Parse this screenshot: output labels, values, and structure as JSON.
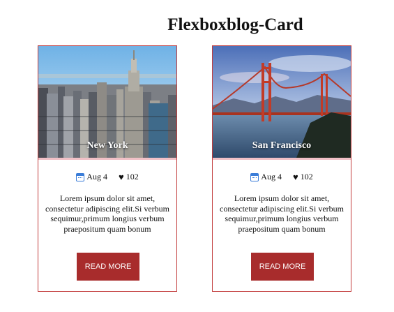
{
  "page": {
    "title": "Flexboxblog-Card"
  },
  "cards": [
    {
      "city": "New York",
      "date": "Aug 4",
      "likes": "102",
      "description": "Lorem ipsum dolor sit amet, consectetur adipiscing elit.Si verbum sequimur,primum longius verbum praepositum quam bonum",
      "button_label": "READ MORE",
      "icons": {
        "date": "calendar-icon",
        "likes": "heart-icon"
      }
    },
    {
      "city": "San Francisco",
      "date": "Aug 4",
      "likes": "102",
      "description": "Lorem ipsum dolor sit amet, consectetur adipiscing elit.Si verbum sequimur,primum longius verbum praepositum quam bonum",
      "button_label": "READ MORE",
      "icons": {
        "date": "calendar-icon",
        "likes": "heart-icon"
      }
    }
  ],
  "colors": {
    "accent": "#a82c2c",
    "card_border": "#c23b3b",
    "image_underline": "#f1c1c7"
  }
}
